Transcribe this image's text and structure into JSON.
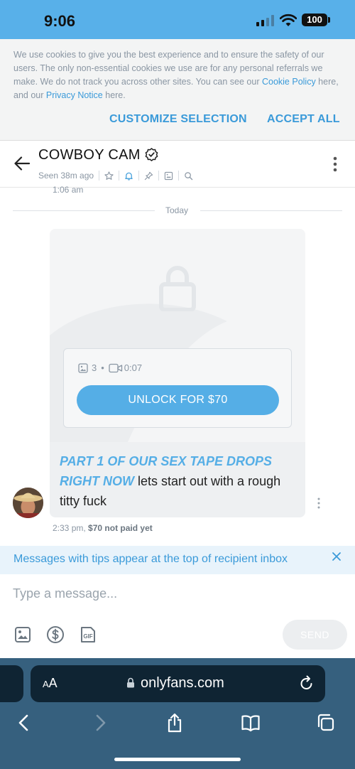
{
  "status_bar": {
    "time": "9:06",
    "battery": "100"
  },
  "cookie_banner": {
    "text_before": "We use cookies to give you the best experience and to ensure the safety of our users. The only non-essential cookies we use are for any personal referrals we make. We do not track you across other sites. You can see our ",
    "cookie_policy_link": "Cookie Policy",
    "text_middle": " here, and our ",
    "privacy_link": "Privacy Notice",
    "text_after": " here.",
    "customize_label": "CUSTOMIZE SELECTION",
    "accept_label": "ACCEPT ALL"
  },
  "chat_header": {
    "title": "COWBOY CAM",
    "seen": "Seen 38m ago"
  },
  "messages": {
    "previous_time": "1:06 am",
    "divider": "Today",
    "media": {
      "image_count": "3",
      "video_duration": "0:07",
      "unlock_label": "UNLOCK FOR $70"
    },
    "text_highlight": "PART 1 OF OUR SEX TAPE DROPS RIGHT NOW",
    "text_body": " lets start out with a rough titty fuck",
    "time": "2:33 pm,",
    "price_status": "$70 not paid yet"
  },
  "tip_banner": {
    "text": "Messages with tips appear at the top of recipient inbox"
  },
  "composer": {
    "placeholder": "Type a message...",
    "send_label": "SEND"
  },
  "browser": {
    "aa_label": "AA",
    "url": "onlyfans.com"
  },
  "colors": {
    "accent": "#55aee6",
    "status_bar": "#58b0e9",
    "browser_bar": "#36607e"
  }
}
